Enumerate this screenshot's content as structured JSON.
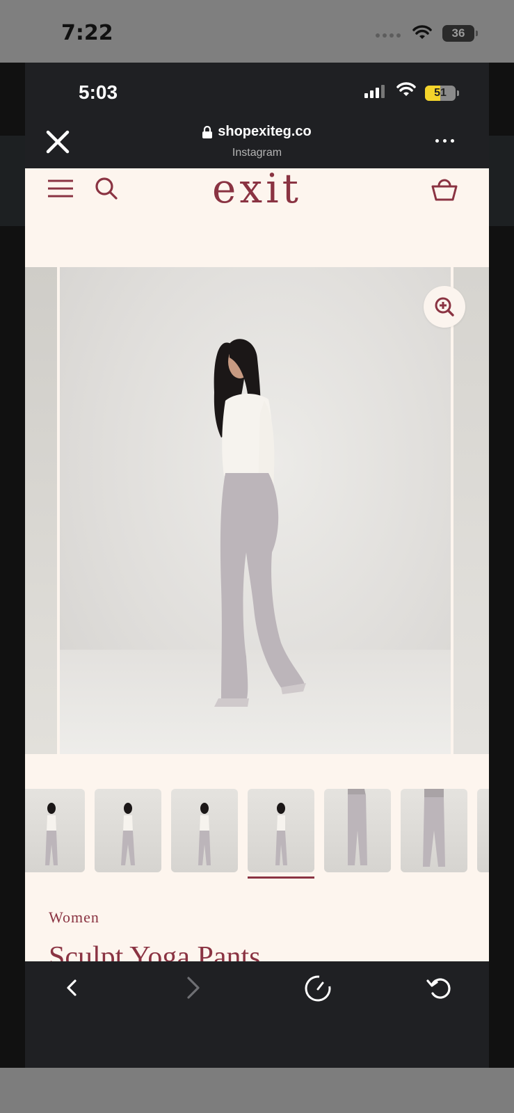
{
  "outer_status": {
    "time": "7:22",
    "battery": "36"
  },
  "inner_status": {
    "time": "5:03",
    "battery": "51",
    "battery_fill_fraction": 0.51
  },
  "browser": {
    "url": "shopexiteg.co",
    "source": "Instagram"
  },
  "site": {
    "logo": "exit",
    "accent_color": "#8a3342",
    "background_color": "#fdf5ee"
  },
  "gallery": {
    "thumbnail_count": 7,
    "active_thumbnail": 4
  },
  "product": {
    "category": "Women",
    "title": "Sculpt Yoga Pants"
  },
  "icons": {
    "close": "close-icon",
    "lock": "lock-icon",
    "more": "more-icon",
    "menu": "menu-icon",
    "search": "search-icon",
    "cart": "basket-icon",
    "zoom": "zoom-in-icon",
    "back": "chevron-left-icon",
    "forward": "chevron-right-icon",
    "speed": "speedometer-icon",
    "reload": "reload-icon"
  }
}
